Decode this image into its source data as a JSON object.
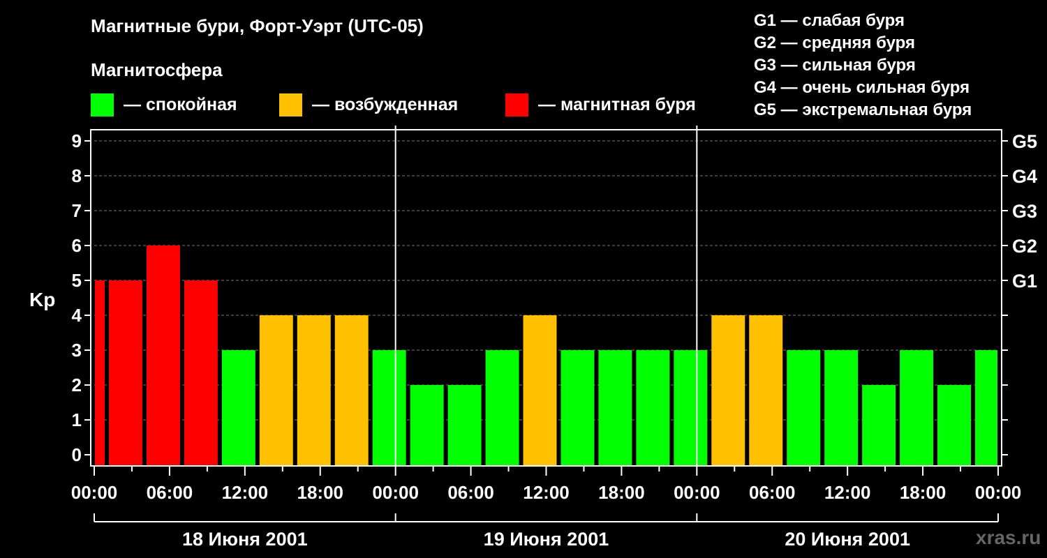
{
  "title": "Магнитные бури, Форт-Уэрт (UTC-05)",
  "magnetosphere_label": "Магнитосфера",
  "legend": [
    {
      "color": "#00ff00",
      "label": "— спокойная"
    },
    {
      "color": "#ffc000",
      "label": "— возбужденная"
    },
    {
      "color": "#ff0000",
      "label": "— магнитная буря"
    }
  ],
  "g_legend": [
    "G1 — слабая буря",
    "G2 — средняя буря",
    "G3 — сильная буря",
    "G4 — очень сильная буря",
    "G5 — экстремальная буря"
  ],
  "watermark": "xras.ru",
  "chart_data": {
    "type": "bar",
    "ylabel": "Kp",
    "ylim": [
      0,
      9
    ],
    "y_ticks": [
      0,
      1,
      2,
      3,
      4,
      5,
      6,
      7,
      8,
      9
    ],
    "right_ticks": [
      {
        "value": 5,
        "label": "G1"
      },
      {
        "value": 6,
        "label": "G2"
      },
      {
        "value": 7,
        "label": "G3"
      },
      {
        "value": 8,
        "label": "G4"
      },
      {
        "value": 9,
        "label": "G5"
      }
    ],
    "x_tick_labels": [
      "00:00",
      "06:00",
      "12:00",
      "18:00",
      "00:00",
      "06:00",
      "12:00",
      "18:00",
      "00:00",
      "06:00",
      "12:00",
      "18:00",
      "00:00"
    ],
    "days": [
      "18 Июня 2001",
      "19 Июня 2001",
      "20 Июня 2001"
    ],
    "bars": [
      {
        "start_hour": -2,
        "value": 5,
        "level": "storm"
      },
      {
        "start_hour": 1,
        "value": 5,
        "level": "storm"
      },
      {
        "start_hour": 4,
        "value": 6,
        "level": "storm"
      },
      {
        "start_hour": 7,
        "value": 5,
        "level": "storm"
      },
      {
        "start_hour": 10,
        "value": 3,
        "level": "quiet"
      },
      {
        "start_hour": 13,
        "value": 4,
        "level": "active"
      },
      {
        "start_hour": 16,
        "value": 4,
        "level": "active"
      },
      {
        "start_hour": 19,
        "value": 4,
        "level": "active"
      },
      {
        "start_hour": 22,
        "value": 3,
        "level": "quiet"
      },
      {
        "start_hour": 25,
        "value": 2,
        "level": "quiet"
      },
      {
        "start_hour": 28,
        "value": 2,
        "level": "quiet"
      },
      {
        "start_hour": 31,
        "value": 3,
        "level": "quiet"
      },
      {
        "start_hour": 34,
        "value": 4,
        "level": "active"
      },
      {
        "start_hour": 37,
        "value": 3,
        "level": "quiet"
      },
      {
        "start_hour": 40,
        "value": 3,
        "level": "quiet"
      },
      {
        "start_hour": 43,
        "value": 3,
        "level": "quiet"
      },
      {
        "start_hour": 46,
        "value": 3,
        "level": "quiet"
      },
      {
        "start_hour": 49,
        "value": 4,
        "level": "active"
      },
      {
        "start_hour": 52,
        "value": 4,
        "level": "active"
      },
      {
        "start_hour": 55,
        "value": 3,
        "level": "quiet"
      },
      {
        "start_hour": 58,
        "value": 3,
        "level": "quiet"
      },
      {
        "start_hour": 61,
        "value": 2,
        "level": "quiet"
      },
      {
        "start_hour": 64,
        "value": 3,
        "level": "quiet"
      },
      {
        "start_hour": 67,
        "value": 2,
        "level": "quiet"
      },
      {
        "start_hour": 70,
        "value": 3,
        "level": "quiet"
      }
    ],
    "colors": {
      "quiet": "#00ff00",
      "active": "#ffc000",
      "storm": "#ff0000"
    },
    "grid": true
  }
}
